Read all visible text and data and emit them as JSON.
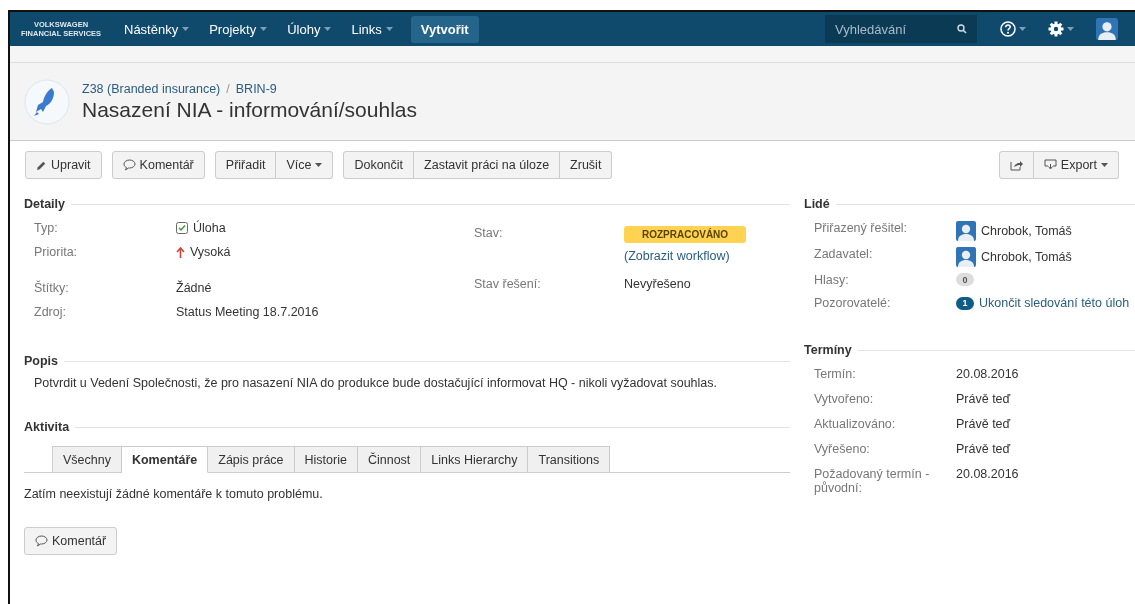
{
  "nav": {
    "logo": [
      "VOLKSWAGEN",
      "FINANCIAL SERVICES"
    ],
    "menus": [
      {
        "label": "Nástěnky"
      },
      {
        "label": "Projekty"
      },
      {
        "label": "Úlohy"
      },
      {
        "label": "Links"
      }
    ],
    "create": "Vytvořit",
    "search": {
      "placeholder": "Vyhledávání"
    }
  },
  "header": {
    "breadcrumb": [
      "Z38 (Branded insurance)",
      "BRIN-9"
    ],
    "separator": "/",
    "title": "Nasazení NIA - informování/souhlas"
  },
  "toolbar": {
    "groups": [
      [
        {
          "label": "Upravit",
          "kind": "edit"
        }
      ],
      [
        {
          "label": "Komentář",
          "kind": "comment"
        }
      ],
      [
        {
          "label": "Přiřadit"
        },
        {
          "label": "Více",
          "dropdown": true
        }
      ],
      [
        {
          "label": "Dokončit"
        },
        {
          "label": "Zastavit práci na úloze"
        },
        {
          "label": "Zrušit"
        }
      ]
    ],
    "right": [
      {
        "kind": "share"
      },
      {
        "label": "Export",
        "kind": "export",
        "dropdown": true
      }
    ]
  },
  "details": {
    "title": "Detaily",
    "groups": [
      [
        {
          "label": "Typ:",
          "value": "Úloha",
          "kind": "type"
        },
        {
          "label": "Priorita:",
          "value": "Vysoká",
          "kind": "priority"
        }
      ],
      [
        {
          "label": "Štítky:",
          "value": "Žádné",
          "kind": "text"
        },
        {
          "label": "Zdroj:",
          "value": "Status Meeting 18.7.2016",
          "kind": "text"
        }
      ]
    ],
    "status": {
      "label": "Stav:",
      "lozenge": "ROZPRACOVÁNO",
      "link": "(Zobrazit workflow)"
    },
    "resolution": {
      "label": "Stav řešení:",
      "value": "Nevyřešeno"
    }
  },
  "description": {
    "title": "Popis",
    "text": "Potvrdit u Vedení Společnosti, že pro nasazení NIA do produkce bude dostačující informovat HQ - nikoli vyžadovat souhlas."
  },
  "activity": {
    "title": "Aktivita",
    "tabs": [
      {
        "label": "Všechny",
        "selected": false
      },
      {
        "label": "Komentáře",
        "selected": true
      },
      {
        "label": "Zápis práce",
        "selected": false
      },
      {
        "label": "Historie",
        "selected": false
      },
      {
        "label": "Činnost",
        "selected": false
      },
      {
        "label": "Links Hierarchy",
        "selected": false
      },
      {
        "label": "Transitions",
        "selected": false
      }
    ],
    "empty": "Zatím neexistují žádné komentáře k tomuto problému.",
    "button": "Komentář"
  },
  "people": {
    "title": "Lidé",
    "rows": [
      {
        "label": "Přiřazený řešitel:",
        "value": "Chrobok, Tomáš",
        "kind": "user"
      },
      {
        "label": "Zadavatel:",
        "value": "Chrobok, Tomáš",
        "kind": "user"
      },
      {
        "label": "Hlasy:",
        "value": "0",
        "kind": "votes"
      },
      {
        "label": "Pozorovatelé:",
        "count": "1",
        "value": "Ukončit sledování této úloh",
        "kind": "watchers"
      }
    ]
  },
  "dates": {
    "title": "Termíny",
    "rows": [
      {
        "label": "Termín:",
        "value": "20.08.2016"
      },
      {
        "label": "Vytvořeno:",
        "value": "Právě teď"
      },
      {
        "label": "Aktualizováno:",
        "value": "Právě teď"
      },
      {
        "label": "Vyřešeno:",
        "value": "Právě teď"
      },
      {
        "label": "Požadovaný termín - původní:",
        "value": "20.08.2016"
      }
    ]
  }
}
